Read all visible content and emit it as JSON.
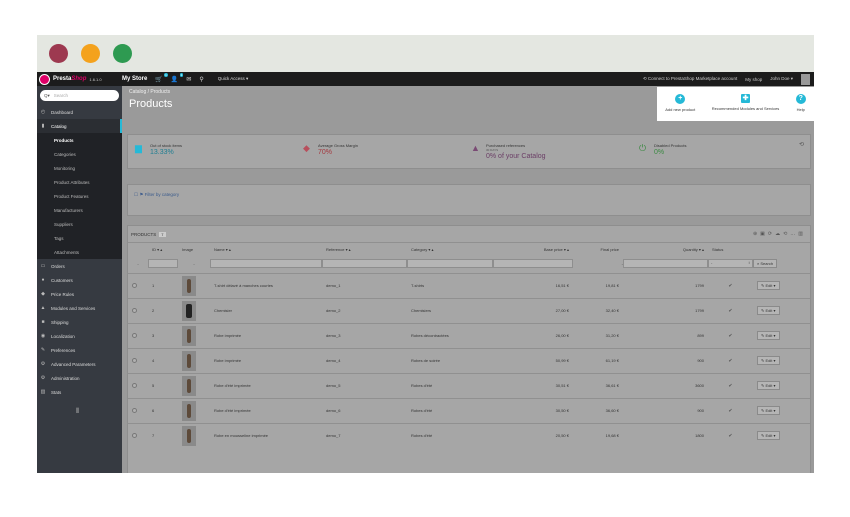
{
  "topbar": {
    "brand_a": "Presta",
    "brand_b": "Shop",
    "version": "1.6.1.0",
    "store": "My Store",
    "cart_count": "1",
    "user_count": "1",
    "quick_access": "Quick Access ▾",
    "connect": "Connect to PrestaShop Marketplace account",
    "myshop": "My shop",
    "user": "John Doe ▾"
  },
  "sidebar": {
    "search_placeholder": "Search",
    "items": [
      {
        "label": "Dashboard",
        "icon": "dashboard-icon"
      },
      {
        "label": "Catalog",
        "icon": "catalog-icon"
      },
      {
        "label": "Orders",
        "icon": "orders-icon"
      },
      {
        "label": "Customers",
        "icon": "customers-icon"
      },
      {
        "label": "Price Rules",
        "icon": "price-rules-icon"
      },
      {
        "label": "Modules and Services",
        "icon": "modules-icon"
      },
      {
        "label": "Shipping",
        "icon": "shipping-icon"
      },
      {
        "label": "Localization",
        "icon": "localization-icon"
      },
      {
        "label": "Preferences",
        "icon": "preferences-icon"
      },
      {
        "label": "Advanced Parameters",
        "icon": "advanced-icon"
      },
      {
        "label": "Administration",
        "icon": "administration-icon"
      },
      {
        "label": "Stats",
        "icon": "stats-icon"
      }
    ],
    "sub_items": [
      "Products",
      "Categories",
      "Monitoring",
      "Product Attributes",
      "Product Features",
      "Manufacturers",
      "Suppliers",
      "Tags",
      "Attachments"
    ]
  },
  "header": {
    "breadcrumb": "Catalog  /  Products",
    "title": "Products",
    "add_label": "Add new product",
    "recommended_label": "Recommended Modules and Services",
    "help_label": "Help"
  },
  "kpis": [
    {
      "label": "Out of stock items",
      "value": "13.33%",
      "color": "#25b9d7"
    },
    {
      "label": "Average Gross Margin",
      "value": "70%",
      "color": "#e08f95"
    },
    {
      "label": "Purchased references",
      "sub": "30 DAYS",
      "value": "0% of your Catalog",
      "color": "#8a5a83"
    },
    {
      "label": "Disabled Products",
      "value": "0%",
      "color": "#72c279"
    }
  ],
  "filter_label": "Filter by category",
  "panel": {
    "title": "PRODUCTS",
    "count": "7",
    "columns": [
      "ID ▾ ▴",
      "Image",
      "Name ▾ ▴",
      "Reference ▾ ▴",
      "Category ▾ ▴",
      "Base price ▾ ▴",
      "Final price",
      "Quantity ▾ ▴",
      "Status"
    ],
    "status_filter": "-",
    "search_btn": "Search",
    "edit_label": "Edit",
    "rows": [
      {
        "id": "1",
        "name": "T-shirt délavé à manches courtes",
        "ref": "demo_1",
        "cat": "T-shirts",
        "base": "16,51 €",
        "final": "19,81 €",
        "qty": "1799"
      },
      {
        "id": "2",
        "name": "Chemisier",
        "ref": "demo_2",
        "cat": "Chemisiers",
        "base": "27,00 €",
        "final": "32,40 €",
        "qty": "1799"
      },
      {
        "id": "3",
        "name": "Robe imprimée",
        "ref": "demo_3",
        "cat": "Robes décontractées",
        "base": "26,00 €",
        "final": "31,20 €",
        "qty": "899"
      },
      {
        "id": "4",
        "name": "Robe imprimée",
        "ref": "demo_4",
        "cat": "Robes de soirée",
        "base": "50,99 €",
        "final": "61,19 €",
        "qty": "900"
      },
      {
        "id": "5",
        "name": "Robe d'été imprimée",
        "ref": "demo_5",
        "cat": "Robes d'été",
        "base": "30,51 €",
        "final": "36,61 €",
        "qty": "3600"
      },
      {
        "id": "6",
        "name": "Robe d'été imprimée",
        "ref": "demo_6",
        "cat": "Robes d'été",
        "base": "30,50 €",
        "final": "36,60 €",
        "qty": "900"
      },
      {
        "id": "7",
        "name": "Robe en mousseline imprimée",
        "ref": "demo_7",
        "cat": "Robes d'été",
        "base": "20,50 €",
        "final": "19,68 €",
        "qty": "1800"
      }
    ]
  },
  "colors": {
    "accent": "#25b9d7",
    "brand": "#df0067",
    "sidebar": "#363a41"
  }
}
